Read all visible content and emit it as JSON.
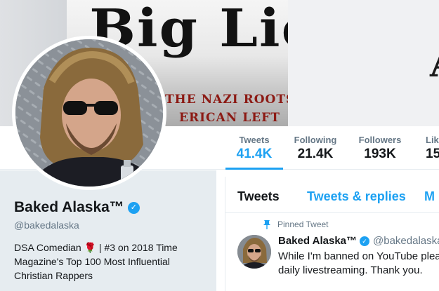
{
  "banner": {
    "book_title": "Big Lie",
    "book_subtitle_line1": "THE NAZI ROOTS OF",
    "book_subtitle_line2": "ERICAN LEFT",
    "edge_glyph": "A"
  },
  "stats": [
    {
      "label": "Tweets",
      "value": "41.4K"
    },
    {
      "label": "Following",
      "value": "21.4K"
    },
    {
      "label": "Followers",
      "value": "193K"
    },
    {
      "label": "Lik",
      "value": "15"
    }
  ],
  "profile": {
    "display_name": "Baked Alaska™",
    "handle": "@bakedalaska",
    "bio_part1": "DSA Comedian ",
    "bio_emoji": "🌹",
    "bio_part2": " | #3 on 2018 Time Magazine's Top 100 Most Influential Christian Rappers",
    "verified_mark": "✓"
  },
  "tabs": {
    "tweets": "Tweets",
    "replies": "Tweets & replies",
    "media": "M"
  },
  "pinned_tweet": {
    "label": "Pinned Tweet",
    "author_name": "Baked Alaska™",
    "author_handle": "@bakedalaska",
    "text": "While I'm banned on YouTube pleas\ndaily livestreaming. Thank you."
  },
  "colors": {
    "accent": "#1da1f2",
    "muted": "#657786",
    "card_bg": "#e6ecf0"
  }
}
